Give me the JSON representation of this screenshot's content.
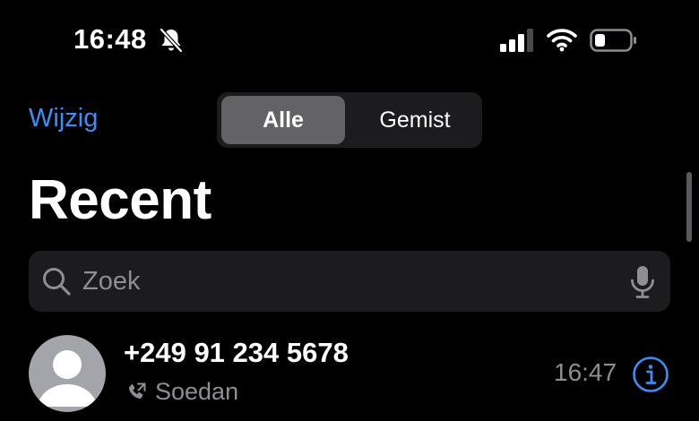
{
  "status_bar": {
    "time": "16:48",
    "icons": [
      "bell-slash-icon",
      "cellular-signal-icon",
      "wifi-icon",
      "battery-icon"
    ]
  },
  "header": {
    "edit_label": "Wijzig",
    "segments": [
      {
        "label": "Alle",
        "selected": true
      },
      {
        "label": "Gemist",
        "selected": false
      }
    ],
    "title": "Recent"
  },
  "search": {
    "placeholder": "Zoek",
    "value": ""
  },
  "calls": [
    {
      "name": "+249 91 234 5678",
      "type_icon": "phone-outgoing-icon",
      "subtitle": "Soedan",
      "time": "16:47"
    }
  ],
  "colors": {
    "accent": "#3a8ef6",
    "background": "#000000",
    "secondary_text": "#8e8e93",
    "segment_bg": "#1c1c1e",
    "segment_selected": "#636366"
  }
}
